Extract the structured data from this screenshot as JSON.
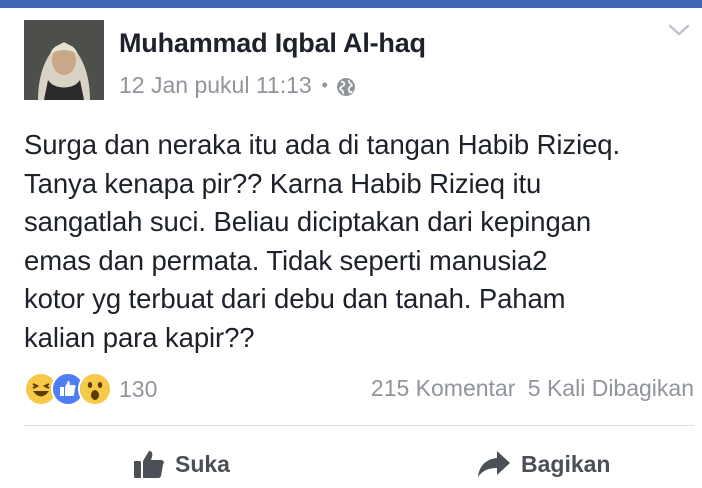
{
  "post": {
    "author": "Muhammad Iqbal Al-haq",
    "timestamp": "12 Jan pukul 11:13",
    "separator": "•",
    "privacy_icon": "globe-icon",
    "menu_icon": "chevron-down-icon",
    "text": "Surga dan neraka itu ada di tangan Habib Rizieq.\nTanya kenapa pir?? Karna Habib Rizieq itu\nsangatlah suci. Beliau diciptakan dari kepingan\nemas dan permata. Tidak seperti manusia2\nkotor yg terbuat dari debu dan tanah. Paham\nkalian para kapir??"
  },
  "reactions": {
    "icons": [
      "haha-icon",
      "like-icon",
      "wow-icon"
    ],
    "count": "130",
    "comments": "215 Komentar",
    "shares": "5 Kali Dibagikan"
  },
  "actions": {
    "like_label": "Suka",
    "share_label": "Bagikan"
  },
  "colors": {
    "brand": "#4267b2",
    "text": "#1d2129",
    "muted": "#90949c",
    "action": "#4b4f56"
  }
}
